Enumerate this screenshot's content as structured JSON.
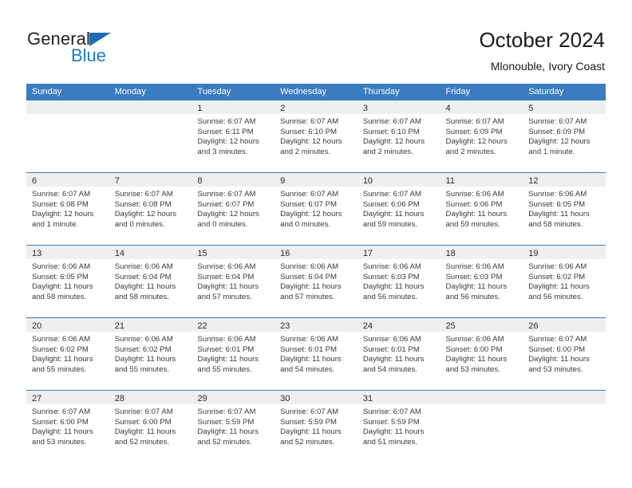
{
  "brand": {
    "name_part1": "General",
    "name_part2": "Blue",
    "triangle_icon": "triangle-icon",
    "color_dark": "#222222",
    "color_blue": "#1d7ac4"
  },
  "header": {
    "title": "October 2024",
    "subtitle": "Mlonouble, Ivory Coast"
  },
  "theme": {
    "header_blue": "#3a7cc0",
    "daynum_band": "#efefef",
    "text": "#3a3a3a"
  },
  "calendar": {
    "weekdays": [
      "Sunday",
      "Monday",
      "Tuesday",
      "Wednesday",
      "Thursday",
      "Friday",
      "Saturday"
    ],
    "weeks": [
      [
        {
          "day": "",
          "sunrise": "",
          "sunset": "",
          "daylight_line1": "",
          "daylight_line2": ""
        },
        {
          "day": "",
          "sunrise": "",
          "sunset": "",
          "daylight_line1": "",
          "daylight_line2": ""
        },
        {
          "day": "1",
          "sunrise": "Sunrise: 6:07 AM",
          "sunset": "Sunset: 6:11 PM",
          "daylight_line1": "Daylight: 12 hours",
          "daylight_line2": "and 3 minutes."
        },
        {
          "day": "2",
          "sunrise": "Sunrise: 6:07 AM",
          "sunset": "Sunset: 6:10 PM",
          "daylight_line1": "Daylight: 12 hours",
          "daylight_line2": "and 2 minutes."
        },
        {
          "day": "3",
          "sunrise": "Sunrise: 6:07 AM",
          "sunset": "Sunset: 6:10 PM",
          "daylight_line1": "Daylight: 12 hours",
          "daylight_line2": "and 2 minutes."
        },
        {
          "day": "4",
          "sunrise": "Sunrise: 6:07 AM",
          "sunset": "Sunset: 6:09 PM",
          "daylight_line1": "Daylight: 12 hours",
          "daylight_line2": "and 2 minutes."
        },
        {
          "day": "5",
          "sunrise": "Sunrise: 6:07 AM",
          "sunset": "Sunset: 6:09 PM",
          "daylight_line1": "Daylight: 12 hours",
          "daylight_line2": "and 1 minute."
        }
      ],
      [
        {
          "day": "6",
          "sunrise": "Sunrise: 6:07 AM",
          "sunset": "Sunset: 6:08 PM",
          "daylight_line1": "Daylight: 12 hours",
          "daylight_line2": "and 1 minute."
        },
        {
          "day": "7",
          "sunrise": "Sunrise: 6:07 AM",
          "sunset": "Sunset: 6:08 PM",
          "daylight_line1": "Daylight: 12 hours",
          "daylight_line2": "and 0 minutes."
        },
        {
          "day": "8",
          "sunrise": "Sunrise: 6:07 AM",
          "sunset": "Sunset: 6:07 PM",
          "daylight_line1": "Daylight: 12 hours",
          "daylight_line2": "and 0 minutes."
        },
        {
          "day": "9",
          "sunrise": "Sunrise: 6:07 AM",
          "sunset": "Sunset: 6:07 PM",
          "daylight_line1": "Daylight: 12 hours",
          "daylight_line2": "and 0 minutes."
        },
        {
          "day": "10",
          "sunrise": "Sunrise: 6:07 AM",
          "sunset": "Sunset: 6:06 PM",
          "daylight_line1": "Daylight: 11 hours",
          "daylight_line2": "and 59 minutes."
        },
        {
          "day": "11",
          "sunrise": "Sunrise: 6:06 AM",
          "sunset": "Sunset: 6:06 PM",
          "daylight_line1": "Daylight: 11 hours",
          "daylight_line2": "and 59 minutes."
        },
        {
          "day": "12",
          "sunrise": "Sunrise: 6:06 AM",
          "sunset": "Sunset: 6:05 PM",
          "daylight_line1": "Daylight: 11 hours",
          "daylight_line2": "and 58 minutes."
        }
      ],
      [
        {
          "day": "13",
          "sunrise": "Sunrise: 6:06 AM",
          "sunset": "Sunset: 6:05 PM",
          "daylight_line1": "Daylight: 11 hours",
          "daylight_line2": "and 58 minutes."
        },
        {
          "day": "14",
          "sunrise": "Sunrise: 6:06 AM",
          "sunset": "Sunset: 6:04 PM",
          "daylight_line1": "Daylight: 11 hours",
          "daylight_line2": "and 58 minutes."
        },
        {
          "day": "15",
          "sunrise": "Sunrise: 6:06 AM",
          "sunset": "Sunset: 6:04 PM",
          "daylight_line1": "Daylight: 11 hours",
          "daylight_line2": "and 57 minutes."
        },
        {
          "day": "16",
          "sunrise": "Sunrise: 6:06 AM",
          "sunset": "Sunset: 6:04 PM",
          "daylight_line1": "Daylight: 11 hours",
          "daylight_line2": "and 57 minutes."
        },
        {
          "day": "17",
          "sunrise": "Sunrise: 6:06 AM",
          "sunset": "Sunset: 6:03 PM",
          "daylight_line1": "Daylight: 11 hours",
          "daylight_line2": "and 56 minutes."
        },
        {
          "day": "18",
          "sunrise": "Sunrise: 6:06 AM",
          "sunset": "Sunset: 6:03 PM",
          "daylight_line1": "Daylight: 11 hours",
          "daylight_line2": "and 56 minutes."
        },
        {
          "day": "19",
          "sunrise": "Sunrise: 6:06 AM",
          "sunset": "Sunset: 6:02 PM",
          "daylight_line1": "Daylight: 11 hours",
          "daylight_line2": "and 56 minutes."
        }
      ],
      [
        {
          "day": "20",
          "sunrise": "Sunrise: 6:06 AM",
          "sunset": "Sunset: 6:02 PM",
          "daylight_line1": "Daylight: 11 hours",
          "daylight_line2": "and 55 minutes."
        },
        {
          "day": "21",
          "sunrise": "Sunrise: 6:06 AM",
          "sunset": "Sunset: 6:02 PM",
          "daylight_line1": "Daylight: 11 hours",
          "daylight_line2": "and 55 minutes."
        },
        {
          "day": "22",
          "sunrise": "Sunrise: 6:06 AM",
          "sunset": "Sunset: 6:01 PM",
          "daylight_line1": "Daylight: 11 hours",
          "daylight_line2": "and 55 minutes."
        },
        {
          "day": "23",
          "sunrise": "Sunrise: 6:06 AM",
          "sunset": "Sunset: 6:01 PM",
          "daylight_line1": "Daylight: 11 hours",
          "daylight_line2": "and 54 minutes."
        },
        {
          "day": "24",
          "sunrise": "Sunrise: 6:06 AM",
          "sunset": "Sunset: 6:01 PM",
          "daylight_line1": "Daylight: 11 hours",
          "daylight_line2": "and 54 minutes."
        },
        {
          "day": "25",
          "sunrise": "Sunrise: 6:06 AM",
          "sunset": "Sunset: 6:00 PM",
          "daylight_line1": "Daylight: 11 hours",
          "daylight_line2": "and 53 minutes."
        },
        {
          "day": "26",
          "sunrise": "Sunrise: 6:07 AM",
          "sunset": "Sunset: 6:00 PM",
          "daylight_line1": "Daylight: 11 hours",
          "daylight_line2": "and 53 minutes."
        }
      ],
      [
        {
          "day": "27",
          "sunrise": "Sunrise: 6:07 AM",
          "sunset": "Sunset: 6:00 PM",
          "daylight_line1": "Daylight: 11 hours",
          "daylight_line2": "and 53 minutes."
        },
        {
          "day": "28",
          "sunrise": "Sunrise: 6:07 AM",
          "sunset": "Sunset: 6:00 PM",
          "daylight_line1": "Daylight: 11 hours",
          "daylight_line2": "and 52 minutes."
        },
        {
          "day": "29",
          "sunrise": "Sunrise: 6:07 AM",
          "sunset": "Sunset: 5:59 PM",
          "daylight_line1": "Daylight: 11 hours",
          "daylight_line2": "and 52 minutes."
        },
        {
          "day": "30",
          "sunrise": "Sunrise: 6:07 AM",
          "sunset": "Sunset: 5:59 PM",
          "daylight_line1": "Daylight: 11 hours",
          "daylight_line2": "and 52 minutes."
        },
        {
          "day": "31",
          "sunrise": "Sunrise: 6:07 AM",
          "sunset": "Sunset: 5:59 PM",
          "daylight_line1": "Daylight: 11 hours",
          "daylight_line2": "and 51 minutes."
        },
        {
          "day": "",
          "sunrise": "",
          "sunset": "",
          "daylight_line1": "",
          "daylight_line2": ""
        },
        {
          "day": "",
          "sunrise": "",
          "sunset": "",
          "daylight_line1": "",
          "daylight_line2": ""
        }
      ]
    ]
  }
}
